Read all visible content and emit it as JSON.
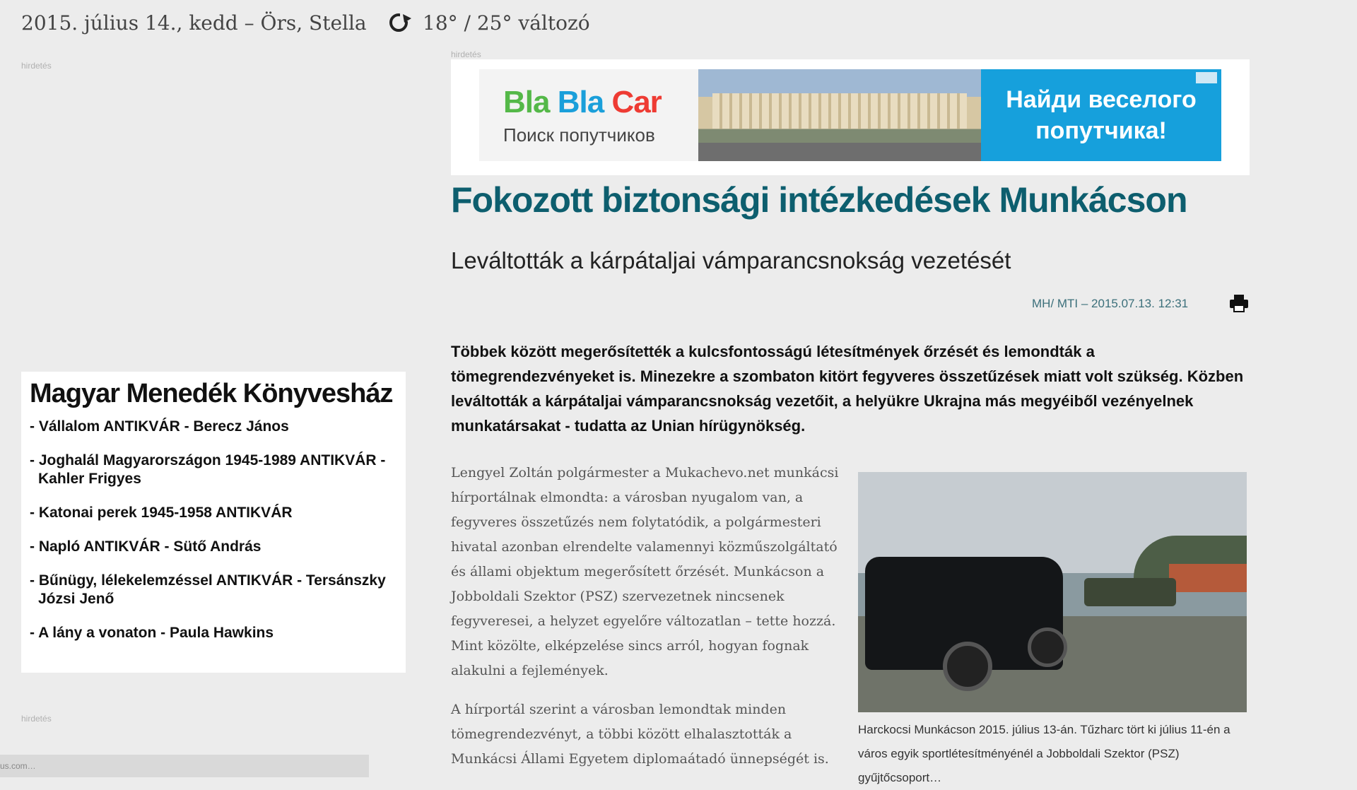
{
  "topbar": {
    "date": "2015. július 14., kedd – Örs, Stella",
    "weather_icon": "weather-icon",
    "temperature": "18° / 25° változó"
  },
  "ads": {
    "left_label_top": "hirdetés",
    "banner_label": "hirdetés",
    "left_label_bottom": "hirdetés"
  },
  "banner": {
    "brand_part1": "Bla",
    "brand_part2": "Bla",
    "brand_part3": "Car",
    "brand_sub": "Поиск попутчиков",
    "cta": "Найди веселого попутчика!",
    "colors": {
      "green": "#54b848",
      "blue": "#1a9fda",
      "red": "#ee3b33",
      "cta_bg": "#16a0dc"
    }
  },
  "article": {
    "title": "Fokozott biztonsági intézkedések Munkácson",
    "subtitle": "Leváltották a kárpátaljai vámparancsnokság vezetését",
    "byline": "MH/ MTI – 2015.07.13. 12:31",
    "lead": "Többek között megerősítették a kulcsfontosságú létesítmények őrzését és lemondták a tömegrendezvényeket is. Minezekre a szombaton kitört fegyveres összetűzések miatt volt szükség. Közben leváltották a kárpátaljai vámparancsnokság vezetőit, a helyükre Ukrajna más megyéiből vezényelnek munkatársakat - tudatta az Unian hírügynökség.",
    "paragraphs": [
      "Lengyel Zoltán polgármester a Mukachevo.net munkácsi hírportálnak elmondta: a városban nyugalom van, a fegyveres összetűzés nem folytatódik, a polgármesteri hivatal azonban elrendelte valamennyi közműszolgáltató és állami objektum megerősített őrzését. Munkácson a Jobboldali Szektor (PSZ) szervezetnek nincsenek fegyveresei, a helyzet egyelőre változatlan – tette hozzá. Mint közölte, elképzelése sincs arról, hogyan fognak alakulni a fejlemények.",
      "A hírportál szerint a városban lemondtak minden tömegrendezvényt, a többi között elhalasztották a Munkácsi Állami Egyetem diplomaátadó ünnepségét is."
    ],
    "figure_caption": "Harckocsi Munkácson 2015. július 13-án. Tűzharc tört ki július 11-én a város egyik sportlétesítményénél a Jobboldali Szektor (PSZ) gyűjtőcsoport…",
    "accent_color": "#0d5e6e"
  },
  "bookbox": {
    "title": "Magyar Menedék Könyvesház",
    "items": [
      "Vállalom ANTIKVÁR - Berecz János",
      "Joghalál Magyarországon 1945-1989 ANTIKVÁR - Kahler Frigyes",
      "Katonai perek 1945-1958 ANTIKVÁR",
      "Napló ANTIKVÁR - Sütő András",
      "Bűnügy, lélekelemzéssel ANTIKVÁR - Tersánszky Józsi Jenő",
      "A lány a vonaton - Paula Hawkins"
    ]
  },
  "footer": {
    "gray_bar_text": "us.com…"
  }
}
